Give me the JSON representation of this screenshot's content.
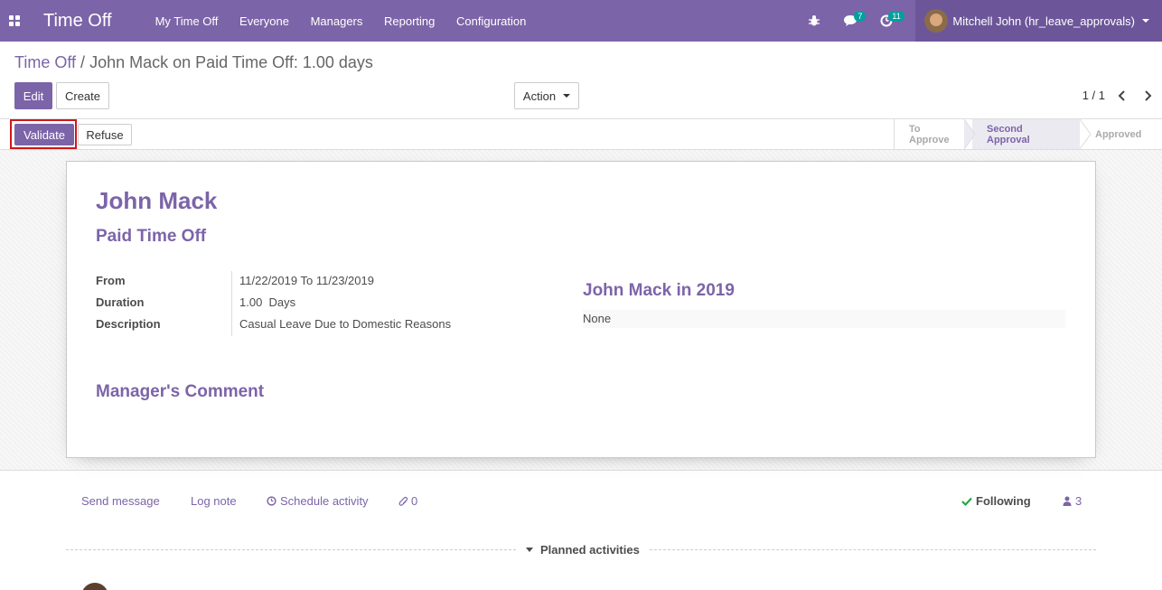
{
  "navbar": {
    "app_title": "Time Off",
    "menu": [
      "My Time Off",
      "Everyone",
      "Managers",
      "Reporting",
      "Configuration"
    ],
    "messages_count": "7",
    "activities_count": "11",
    "user_name": "Mitchell John (hr_leave_approvals)"
  },
  "breadcrumb": {
    "parent": "Time Off",
    "separator": "/",
    "current": "John Mack on Paid Time Off: 1.00 days"
  },
  "buttons": {
    "edit": "Edit",
    "create": "Create",
    "action": "Action",
    "validate": "Validate",
    "refuse": "Refuse"
  },
  "pager": {
    "value": "1 / 1"
  },
  "statusbar": {
    "stages": [
      "To Approve",
      "Second Approval",
      "Approved"
    ],
    "active_stage": "Second Approval"
  },
  "form": {
    "employee": "John Mack",
    "leave_type": "Paid Time Off",
    "from_label": "From",
    "from_date": "11/22/2019",
    "to_label": "To",
    "to_date": "11/23/2019",
    "duration_label": "Duration",
    "duration_value": "1.00",
    "duration_unit": "Days",
    "description_label": "Description",
    "description_value": "Casual Leave Due to Domestic Reasons",
    "summary_title": "John Mack in 2019",
    "summary_value": "None",
    "manager_comment_title": "Manager's Comment"
  },
  "chatter": {
    "send_message": "Send message",
    "log_note": "Log note",
    "schedule_activity": "Schedule activity",
    "attachments": "0",
    "following": "Following",
    "followers": "3",
    "planned_activities": "Planned activities"
  },
  "colors": {
    "brand": "#7c64a8",
    "highlight_border": "#d0171a",
    "following_check": "#28a745"
  }
}
